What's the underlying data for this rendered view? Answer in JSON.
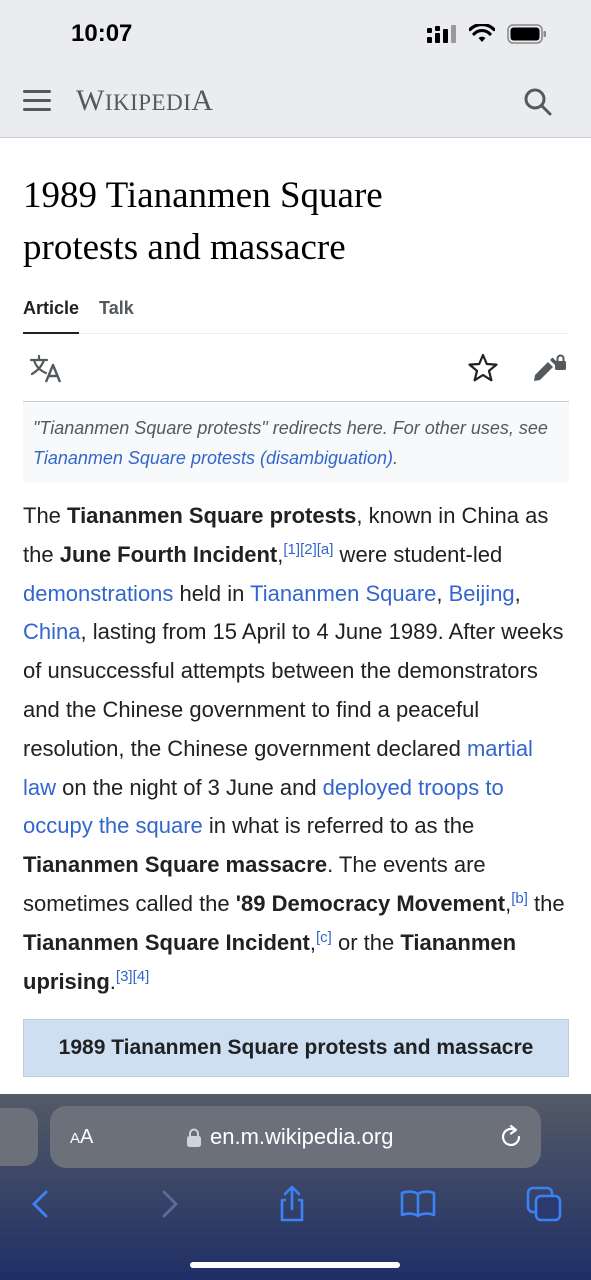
{
  "status_bar": {
    "time": "10:07"
  },
  "header": {
    "wordmark": "WIKIPEDIA"
  },
  "article": {
    "title_line1": "1989 Tiananmen Square",
    "title_line2": "protests and massacre",
    "tabs": [
      "Article",
      "Talk"
    ],
    "hatnote_text": "\"Tiananmen Square protests\" redirects here. For other uses, see ",
    "hatnote_link": "Tiananmen Square protests (disambiguation)",
    "hatnote_end": ".",
    "lead": {
      "t1": "The ",
      "b1": "Tiananmen Square protests",
      "t2": ", known in China as the ",
      "b2": "June Fourth Incident",
      "t3": ",",
      "refs1": "[1][2][a]",
      "t4": " were student-led ",
      "l1": "demonstrations",
      "t5": " held in ",
      "l2": "Tiananmen Square",
      "t6": ", ",
      "l3": "Beijing",
      "t7": ", ",
      "l4": "China",
      "t8": ", lasting from 15 April to 4 June 1989. After weeks of unsuccessful attempts between the demonstrators and the Chinese government to find a peaceful resolution, the Chinese government declared ",
      "l5": "martial law",
      "t9": " on the night of 3 June and ",
      "l6": "deployed troops to occupy the square",
      "t10": " in what is referred to as the ",
      "b3": "Tiananmen Square massacre",
      "t11": ". The events are sometimes called the ",
      "b4": "'89 Democracy Movement",
      "t12": ",",
      "refs2": "[b]",
      "t13": " the ",
      "b5": "Tiananmen Square Incident",
      "t14": ",",
      "refs3": "[c]",
      "t15": " or the ",
      "b6": "Tiananmen uprising",
      "t16": ".",
      "refs4": "[3][4]"
    },
    "infobox_title": "1989 Tiananmen Square protests and massacre"
  },
  "browser": {
    "aa_label_big": "A",
    "aa_label_small": "A",
    "url": "en.m.wikipedia.org"
  },
  "colors": {
    "link": "#3366cc",
    "chrome": "#eaecf0",
    "infobox": "#cedff2"
  }
}
